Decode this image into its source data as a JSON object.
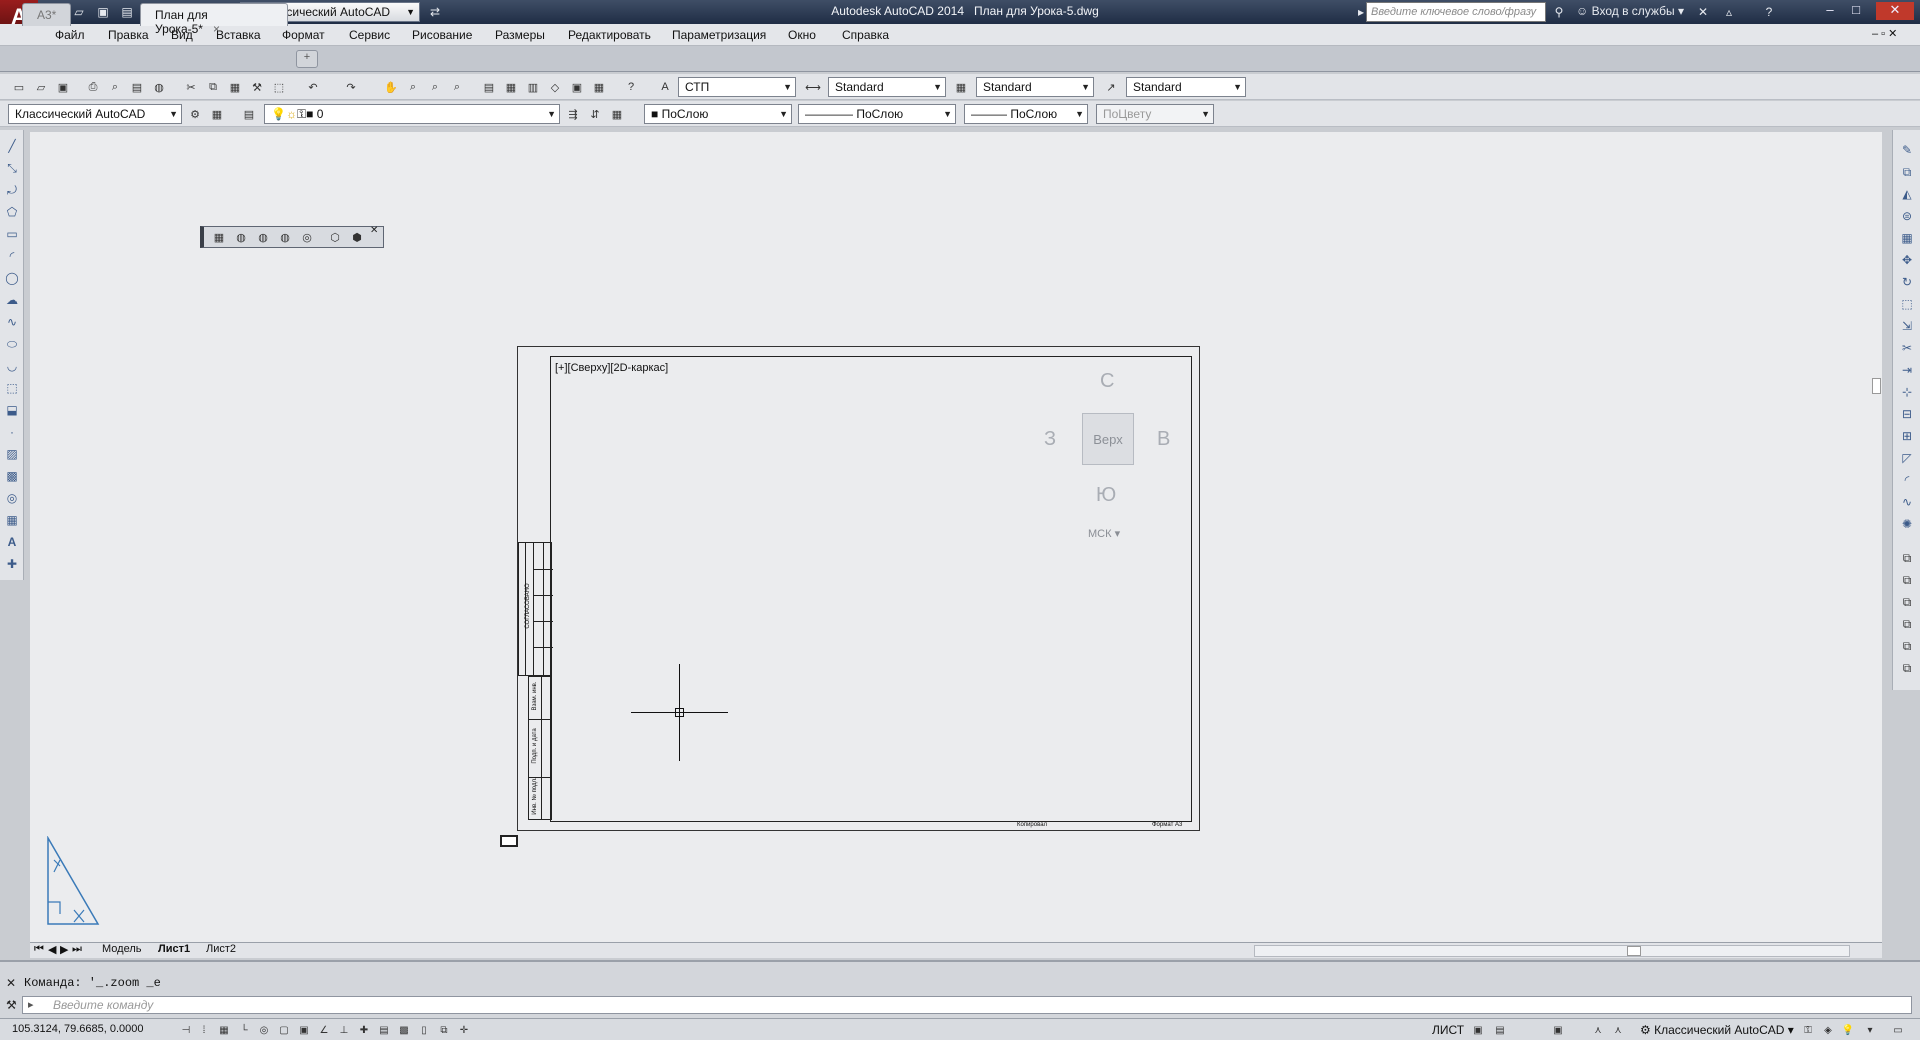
{
  "app": {
    "title": "Autodesk AutoCAD 2014",
    "document": "План для Урока-5.dwg",
    "workspace": "Классический AutoCAD",
    "search_placeholder": "Введите ключевое слово/фразу",
    "login": "Вход в службы",
    "logo": "A"
  },
  "menu": [
    "Файл",
    "Правка",
    "Вид",
    "Вставка",
    "Формат",
    "Сервис",
    "Рисование",
    "Размеры",
    "Редактировать",
    "Параметризация",
    "Окно",
    "Справка"
  ],
  "tabs": [
    "А3*",
    "План для Урока-5*"
  ],
  "toolbar": {
    "text_style": "СТП",
    "dim_style": "Standard",
    "table_style": "Standard",
    "mleader_style": "Standard",
    "workspace": "Классический AutoCAD",
    "layer": "0",
    "color": "ПоСлою",
    "linetype": "ПоСлою",
    "lineweight": "ПоСлою",
    "plotstyle": "ПоЦвету"
  },
  "viewport": {
    "label": "[+][Сверху][2D-каркас]",
    "viewcube": {
      "north": "С",
      "south": "Ю",
      "west": "З",
      "east": "В",
      "face": "Верх",
      "ucs": "МСК"
    }
  },
  "titleblock": {
    "side_labels": [
      "СОГЛАСОВАНО",
      "Взам. инв.",
      "Подп. и дата",
      "Инв. № подл."
    ],
    "bottom_left": "Копировал",
    "bottom_right": "Формат А3"
  },
  "layout_tabs": [
    "Модель",
    "Лист1",
    "Лист2"
  ],
  "command": {
    "history": "Команда: '_.zoom _e",
    "placeholder": "Введите команду"
  },
  "status": {
    "coords": "105.3124, 79.6685, 0.0000",
    "space": "ЛИСТ",
    "workspace": "Классический AutoCAD"
  },
  "colors": {
    "titlebar": "#2b3a55",
    "canvas": "#ebecee",
    "accent": "#b31b1b"
  }
}
